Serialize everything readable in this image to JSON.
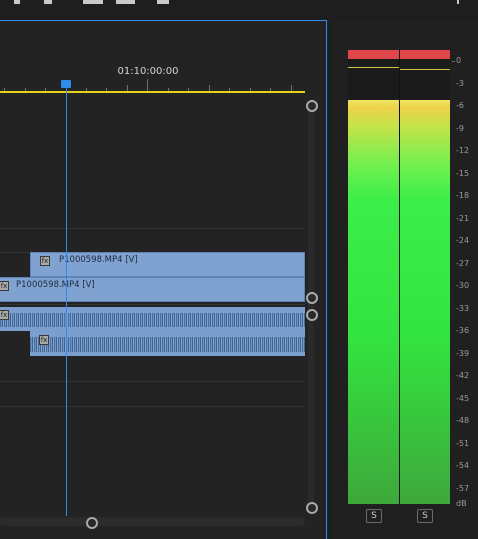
{
  "timeline": {
    "timecode": "01:10:00:00",
    "clips": {
      "v2": "P1000598.MP4 [V]",
      "v1": "P1000598.MP4 [V]"
    },
    "fx_badge": "fx"
  },
  "meters": {
    "scale": [
      "0",
      "-3",
      "-6",
      "-9",
      "-12",
      "-15",
      "-18",
      "-21",
      "-24",
      "-27",
      "-30",
      "-33",
      "-36",
      "-39",
      "-42",
      "-45",
      "-48",
      "-51",
      "-54",
      "-57",
      "dB"
    ],
    "solo_left": "S",
    "solo_right": "S",
    "colors": {
      "peak": "#e0474a",
      "low": "#3ea83b",
      "mid": "#33e33f",
      "high": "#f1e55f"
    }
  },
  "colors": {
    "playhead": "#2d8ceb",
    "work_area": "#e6d21a",
    "clip": "#7fa2d1"
  }
}
